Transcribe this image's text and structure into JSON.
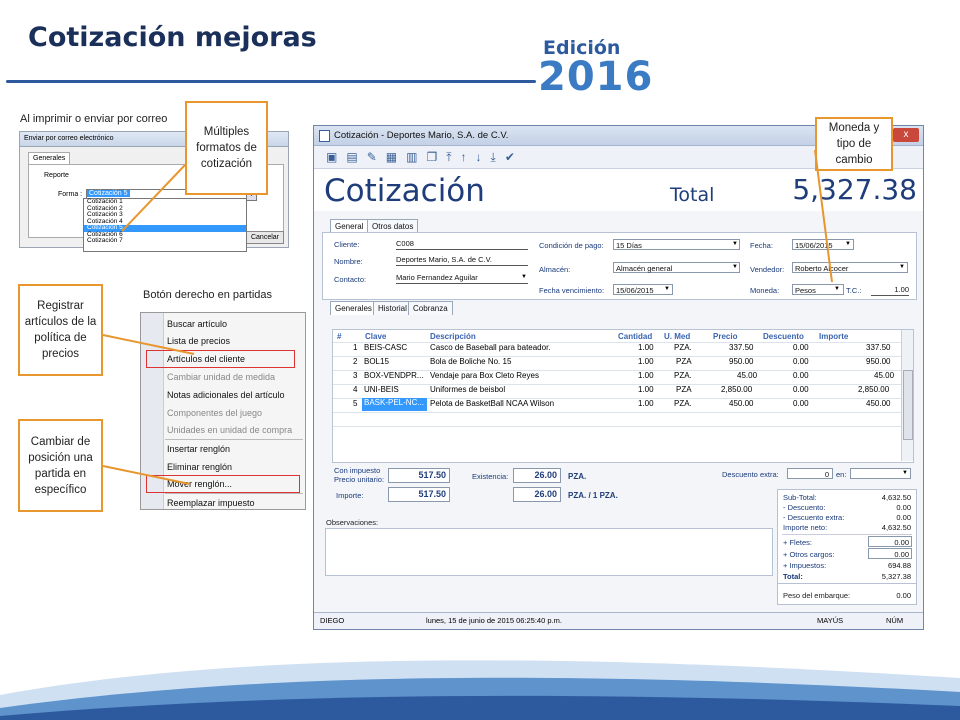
{
  "slide": {
    "title": "Cotización mejoras",
    "edition_label": "Edición",
    "edition_year": "2016"
  },
  "callouts": {
    "formats": "Múltiples formatos de cotización",
    "currency": "Moneda y tipo de cambio",
    "register": "Registrar artículos de la política de precios",
    "move": "Cambiar de posición una partida en específico"
  },
  "captions": {
    "print_email": "Al imprimir o enviar por correo",
    "right_click": "Botón derecho en partidas"
  },
  "email_dialog": {
    "title": "Enviar por correo electrónico",
    "tab": "Generales",
    "report_label": "Reporte",
    "form_label": "Forma :",
    "form_value": "Cotización 5",
    "options": [
      "Cotización 1",
      "Cotización 2",
      "Cotización 3",
      "Cotización 4",
      "Cotización 5",
      "Cotización 6",
      "Cotización 7"
    ],
    "selected_index": 4,
    "cancel_label": "Cancelar"
  },
  "context_menu": {
    "items": [
      {
        "label": "Buscar artículo",
        "enabled": true
      },
      {
        "label": "Lista de precios",
        "enabled": true
      },
      {
        "label": "Artículos del cliente",
        "enabled": true
      },
      {
        "label": "Cambiar unidad de medida",
        "enabled": false
      },
      {
        "label": "Notas adicionales del artículo",
        "enabled": true
      },
      {
        "label": "Componentes del juego",
        "enabled": false
      },
      {
        "label": "Unidades en unidad de compra",
        "enabled": false
      },
      {
        "label": "Insertar renglón",
        "enabled": true
      },
      {
        "label": "Eliminar renglón",
        "enabled": true
      },
      {
        "label": "Mover renglón...",
        "enabled": true
      },
      {
        "label": "Reemplazar impuesto",
        "enabled": true
      }
    ]
  },
  "window": {
    "title": "Cotización - Deportes Mario, S.A. de C.V.",
    "close": "x",
    "heading": "Cotización",
    "total_label": "Total",
    "total_value": "5,327.38",
    "tabs": [
      "General",
      "Otros datos"
    ],
    "form": {
      "cliente_label": "Cliente:",
      "cliente": "C008",
      "nombre_label": "Nombre:",
      "nombre": "Deportes Mario, S.A. de C.V.",
      "contacto_label": "Contacto:",
      "contacto": "Mario Fernandez Aguilar",
      "condicion_label": "Condición de pago:",
      "condicion": "15 Días",
      "almacen_label": "Almacén:",
      "almacen": "Almacén general",
      "fecha_venc_label": "Fecha vencimiento:",
      "fecha_venc": "15/06/2015",
      "fecha_label": "Fecha:",
      "fecha": "15/06/2015",
      "vendedor_label": "Vendedor:",
      "vendedor": "Roberto Alcocer",
      "moneda_label": "Moneda:",
      "moneda": "Pesos",
      "tc_label": "T.C.:",
      "tc": "1.00"
    },
    "detail_tabs": [
      "Generales",
      "Historial",
      "Cobranza"
    ],
    "grid": {
      "headers": [
        "#",
        "Clave",
        "Descripción",
        "Cantidad",
        "U. Med",
        "Precio",
        "Descuento",
        "Importe"
      ],
      "rows": [
        [
          "1",
          "BEIS-CASC",
          "Casco de Baseball para bateador.",
          "1.00",
          "PZA.",
          "337.50",
          "0.00",
          "337.50"
        ],
        [
          "2",
          "BOL15",
          "Bola de Boliche No. 15",
          "1.00",
          "PZA",
          "950.00",
          "0.00",
          "950.00"
        ],
        [
          "3",
          "BOX-VENDPR...",
          "Vendaje para Box Cleto Reyes",
          "1.00",
          "PZA.",
          "45.00",
          "0.00",
          "45.00"
        ],
        [
          "4",
          "UNI-BEIS",
          "Uniformes de beisbol",
          "1.00",
          "PZA",
          "2,850.00",
          "0.00",
          "2,850.00"
        ],
        [
          "5",
          "BASK-PEL-NC...",
          "Pelota de BasketBall NCAA Wilson",
          "1.00",
          "PZA.",
          "450.00",
          "0.00",
          "450.00"
        ]
      ]
    },
    "bottom": {
      "precio_label": "Con impuesto Precio unitario:",
      "precio": "517.50",
      "existencia_label": "Existencia:",
      "existencia": "26.00",
      "existencia_unit": "PZA.",
      "importe_label": "Importe:",
      "importe": "517.50",
      "importe2": "26.00",
      "importe2_unit": "PZA. / 1 PZA.",
      "desc_extra_label": "Descuento extra:",
      "desc_extra": "0",
      "en_label": "en:",
      "obs_label": "Observaciones:"
    },
    "summary": [
      {
        "label": "Sub-Total:",
        "value": "4,632.50"
      },
      {
        "label": "- Descuento:",
        "value": "0.00"
      },
      {
        "label": "- Descuento extra:",
        "value": "0.00"
      },
      {
        "label": "Importe neto:",
        "value": "4,632.50"
      },
      {
        "label": "+ Fletes:",
        "value": "0.00"
      },
      {
        "label": "+ Otros cargos:",
        "value": "0.00"
      },
      {
        "label": "+ Impuestos:",
        "value": "694.88"
      },
      {
        "label": "Total:",
        "value": "5,327.38"
      }
    ],
    "peso_label": "Peso del embarque:",
    "peso": "0.00",
    "status": {
      "user": "DIEGO",
      "datetime": "lunes, 15 de junio de 2015 06:25:40 p.m.",
      "caps": "MAYÚS",
      "num": "NÚM"
    }
  }
}
